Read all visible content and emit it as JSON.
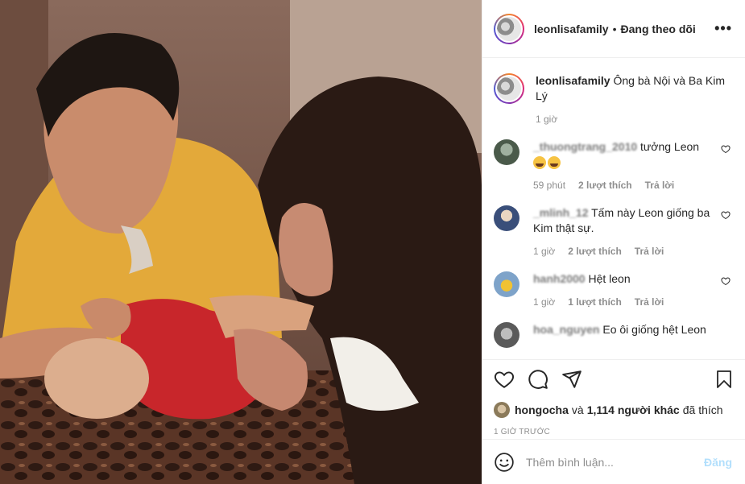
{
  "header": {
    "username": "leonlisafamily",
    "separator": "•",
    "follow_status": "Đang theo dõi",
    "more": "•••"
  },
  "caption": {
    "username": "leonlisafamily",
    "text": "Ông bà Nội và Ba Kim Lý",
    "time": "1 giờ"
  },
  "comments": [
    {
      "username": "_thuongtrang_2010",
      "text": "tưởng Leon",
      "time": "59 phút",
      "likes": "2 lượt thích",
      "reply": "Trả lời",
      "avatar_color": "#4a5a4a"
    },
    {
      "username": "_mlinh_12",
      "text": "Tấm này Leon giống ba Kim thật sự.",
      "time": "1 giờ",
      "likes": "2 lượt thích",
      "reply": "Trả lời",
      "avatar_color": "#3a4f7a"
    },
    {
      "username": "hanh2000",
      "text": "Hệt leon",
      "time": "1 giờ",
      "likes": "1 lượt thích",
      "reply": "Trả lời",
      "avatar_color": "#7ea3c9"
    },
    {
      "username": "hoa_nguyen",
      "text": "Eo ôi giống hệt Leon",
      "time": "",
      "likes": "",
      "reply": "",
      "avatar_color": "#5a5a5a"
    }
  ],
  "actions": {
    "like_icon": "heart-icon",
    "comment_icon": "comment-icon",
    "share_icon": "share-icon",
    "save_icon": "bookmark-icon"
  },
  "likes": {
    "first_liker": "hongocha",
    "connector": "và",
    "others": "1,114 người khác",
    "suffix": "đã thích"
  },
  "timestamp": "1 GIỜ TRƯỚC",
  "add_comment": {
    "placeholder": "Thêm bình luận...",
    "post_label": "Đăng"
  },
  "colors": {
    "text": "#262626",
    "muted": "#8e8e8e",
    "border": "#efefef",
    "post_disabled": "#b2dffc"
  }
}
